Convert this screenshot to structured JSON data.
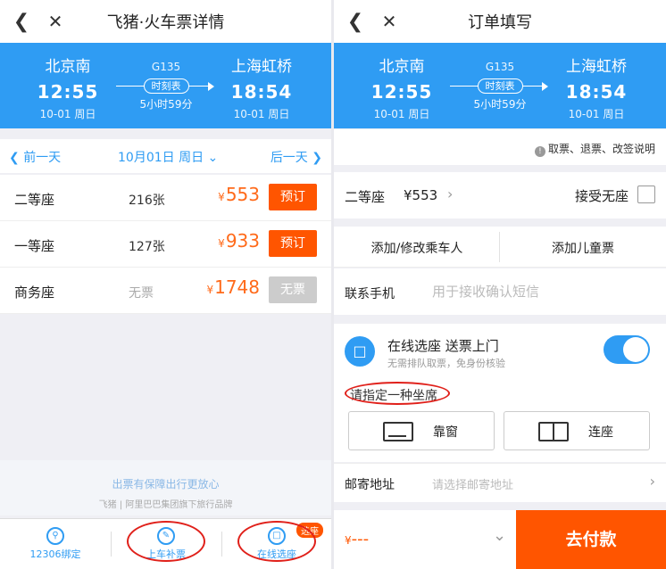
{
  "left": {
    "header": {
      "title": "飞猪·火车票详情"
    },
    "train": {
      "from": {
        "station": "北京南",
        "time": "12:55",
        "date": "10-01 周日"
      },
      "to": {
        "station": "上海虹桥",
        "time": "18:54",
        "date": "10-01 周日"
      },
      "code": "G135",
      "schedule_label": "时刻表",
      "duration": "5小时59分"
    },
    "daybar": {
      "prev": "前一天",
      "current": "10月01日 周日",
      "next": "后一天"
    },
    "seats": [
      {
        "name": "二等座",
        "count": "216张",
        "currency": "¥",
        "price": "553",
        "action": "预订",
        "available": true
      },
      {
        "name": "一等座",
        "count": "127张",
        "currency": "¥",
        "price": "933",
        "action": "预订",
        "available": true
      },
      {
        "name": "商务座",
        "count": "无票",
        "currency": "¥",
        "price": "1748",
        "action": "无票",
        "available": false
      }
    ],
    "guarantee": {
      "line1": "出票有保障出行更放心",
      "line2": "飞猪 | 阿里巴巴集团旗下旅行品牌"
    },
    "tabs": [
      {
        "label": "12306绑定",
        "icon": "link-icon"
      },
      {
        "label": "上车补票",
        "icon": "ticket-icon"
      },
      {
        "label": "在线选座",
        "icon": "seat-icon",
        "badge": "选座"
      }
    ]
  },
  "right": {
    "header": {
      "title": "订单填写"
    },
    "train": {
      "from": {
        "station": "北京南",
        "time": "12:55",
        "date": "10-01 周日"
      },
      "to": {
        "station": "上海虹桥",
        "time": "18:54",
        "date": "10-01 周日"
      },
      "code": "G135",
      "schedule_label": "时刻表",
      "duration": "5小时59分"
    },
    "notice": "取票、退票、改签说明",
    "seat_select": {
      "label": "二等座",
      "price": "¥553",
      "accept_no_seat": "接受无座"
    },
    "passengers": {
      "add_edit": "添加/修改乘车人",
      "add_child": "添加儿童票"
    },
    "phone": {
      "label": "联系手机",
      "placeholder": "用于接收确认短信"
    },
    "online_seat": {
      "title": "在线选座  送票上门",
      "subtitle": "无需排队取票，免身份核验",
      "enabled": true,
      "hint": "请指定一种坐席",
      "options": [
        "靠窗",
        "连座"
      ]
    },
    "address": {
      "label": "邮寄地址",
      "placeholder": "请选择邮寄地址"
    },
    "pay": {
      "currency": "¥",
      "total": "---",
      "button": "去付款"
    }
  },
  "colors": {
    "brand_blue": "#2f9cf3",
    "accent_orange": "#ff5500",
    "price_orange": "#ff6a1a",
    "annotation_red": "#e0201a"
  }
}
